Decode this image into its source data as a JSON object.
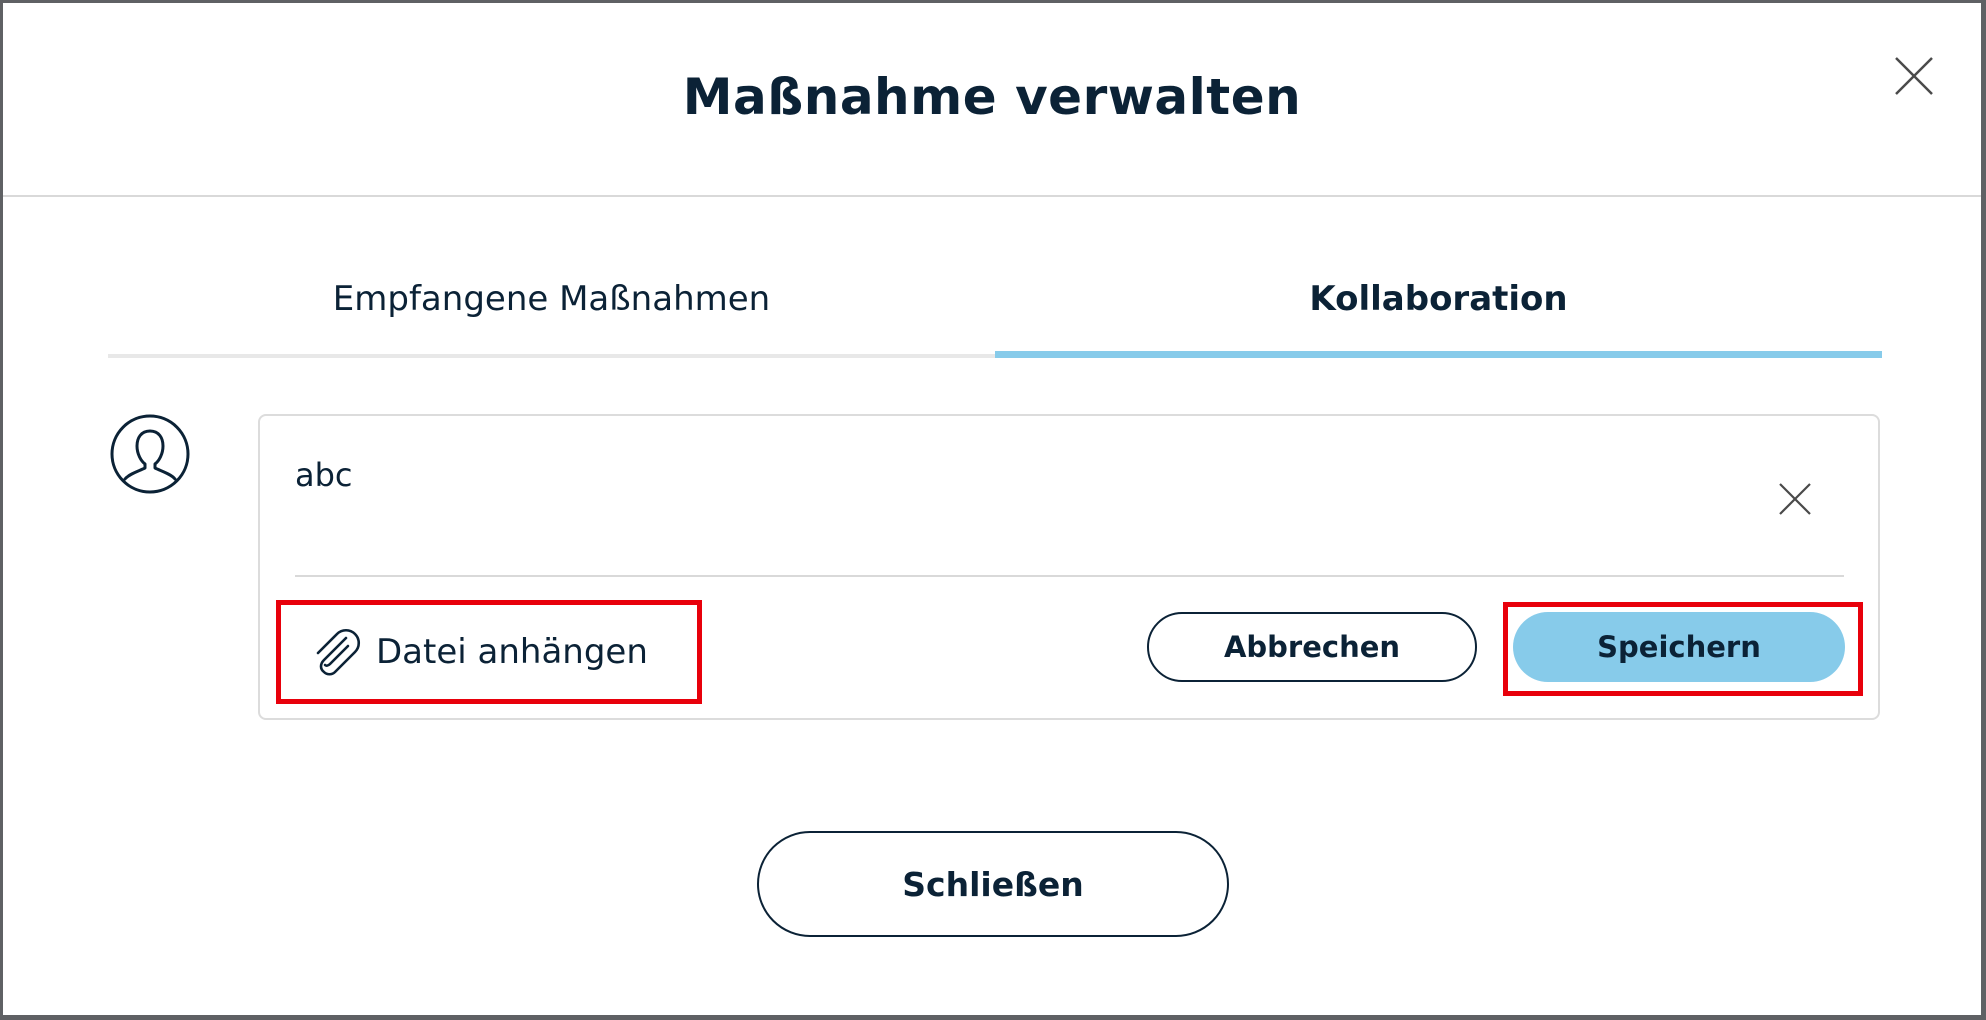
{
  "dialog": {
    "title": "Maßnahme verwalten"
  },
  "tabs": [
    {
      "label": "Empfangene Maßnahmen",
      "active": false
    },
    {
      "label": "Kollaboration",
      "active": true
    }
  ],
  "comment": {
    "text": "abc",
    "attach_label": "Datei anhängen",
    "cancel_label": "Abbrechen",
    "save_label": "Speichern"
  },
  "footer": {
    "close_label": "Schließen"
  },
  "icons": {
    "dialog_close": "close-icon",
    "avatar": "user-avatar-icon",
    "clear": "clear-icon",
    "attach": "paperclip-icon"
  },
  "colors": {
    "text": "#0b2236",
    "accent": "#87cbea",
    "highlight": "#e8000b"
  }
}
